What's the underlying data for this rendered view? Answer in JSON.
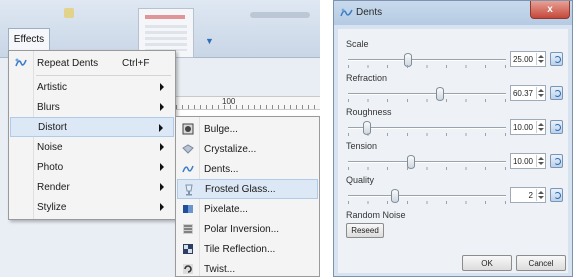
{
  "menu_bar": {
    "effects_label": "Effects"
  },
  "effects_menu": {
    "repeat": {
      "label": "Repeat Dents",
      "shortcut": "Ctrl+F",
      "icon": "dents-icon"
    },
    "items": [
      {
        "label": "Artistic",
        "has_submenu": true
      },
      {
        "label": "Blurs",
        "has_submenu": true
      },
      {
        "label": "Distort",
        "has_submenu": true,
        "highlighted": true
      },
      {
        "label": "Noise",
        "has_submenu": true
      },
      {
        "label": "Photo",
        "has_submenu": true
      },
      {
        "label": "Render",
        "has_submenu": true
      },
      {
        "label": "Stylize",
        "has_submenu": true
      }
    ]
  },
  "ruler": {
    "tick_label": "100"
  },
  "distort_submenu": {
    "items": [
      {
        "label": "Bulge...",
        "icon": "bulge-icon"
      },
      {
        "label": "Crystalize...",
        "icon": "crystalize-icon"
      },
      {
        "label": "Dents...",
        "icon": "dents-icon"
      },
      {
        "label": "Frosted Glass...",
        "icon": "frosted-glass-icon",
        "highlighted": true
      },
      {
        "label": "Pixelate...",
        "icon": "pixelate-icon"
      },
      {
        "label": "Polar Inversion...",
        "icon": "polar-inversion-icon"
      },
      {
        "label": "Tile Reflection...",
        "icon": "tile-reflection-icon"
      },
      {
        "label": "Twist...",
        "icon": "twist-icon"
      }
    ]
  },
  "dents_dialog": {
    "title": "Dents",
    "close_label": "x",
    "params": [
      {
        "label": "Scale",
        "value": "25.00",
        "slider_fraction": 0.38
      },
      {
        "label": "Refraction",
        "value": "60.37",
        "slider_fraction": 0.58
      },
      {
        "label": "Roughness",
        "value": "10.00",
        "slider_fraction": 0.12
      },
      {
        "label": "Tension",
        "value": "10.00",
        "slider_fraction": 0.4
      },
      {
        "label": "Quality",
        "value": "2",
        "slider_fraction": 0.3
      }
    ],
    "random_noise_label": "Random Noise",
    "reseed_label": "Reseed",
    "ok_label": "OK",
    "cancel_label": "Cancel"
  }
}
